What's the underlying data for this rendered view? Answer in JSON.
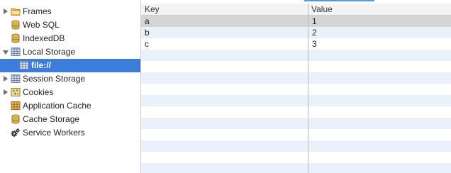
{
  "sidebar": {
    "items": [
      {
        "label": "Frames",
        "icon": "folder-icon",
        "arrow": "collapsed",
        "child": false,
        "selected": false
      },
      {
        "label": "Web SQL",
        "icon": "database-icon",
        "arrow": "none",
        "child": false,
        "selected": false
      },
      {
        "label": "IndexedDB",
        "icon": "database-icon",
        "arrow": "none",
        "child": false,
        "selected": false
      },
      {
        "label": "Local Storage",
        "icon": "table-icon",
        "arrow": "expanded",
        "child": false,
        "selected": false
      },
      {
        "label": "file://",
        "icon": "table-icon",
        "arrow": "none",
        "child": true,
        "selected": true
      },
      {
        "label": "Session Storage",
        "icon": "table-icon",
        "arrow": "collapsed",
        "child": false,
        "selected": false
      },
      {
        "label": "Cookies",
        "icon": "cookie-icon",
        "arrow": "collapsed",
        "child": false,
        "selected": false
      },
      {
        "label": "Application Cache",
        "icon": "grid-icon",
        "arrow": "none",
        "child": false,
        "selected": false
      },
      {
        "label": "Cache Storage",
        "icon": "database-icon",
        "arrow": "none",
        "child": false,
        "selected": false
      },
      {
        "label": "Service Workers",
        "icon": "gears-icon",
        "arrow": "none",
        "child": false,
        "selected": false
      }
    ]
  },
  "grid": {
    "columns": {
      "key": "Key",
      "value": "Value"
    },
    "rows": [
      {
        "key": "a",
        "value": "1",
        "selected": true
      },
      {
        "key": "b",
        "value": "2",
        "selected": false
      },
      {
        "key": "c",
        "value": "3",
        "selected": false
      }
    ]
  },
  "colors": {
    "selection_blue": "#3b7dd8",
    "stripe": "#ebf1fb",
    "row_selected": "#d4d4d4",
    "header_bg": "#f3f3f3"
  }
}
